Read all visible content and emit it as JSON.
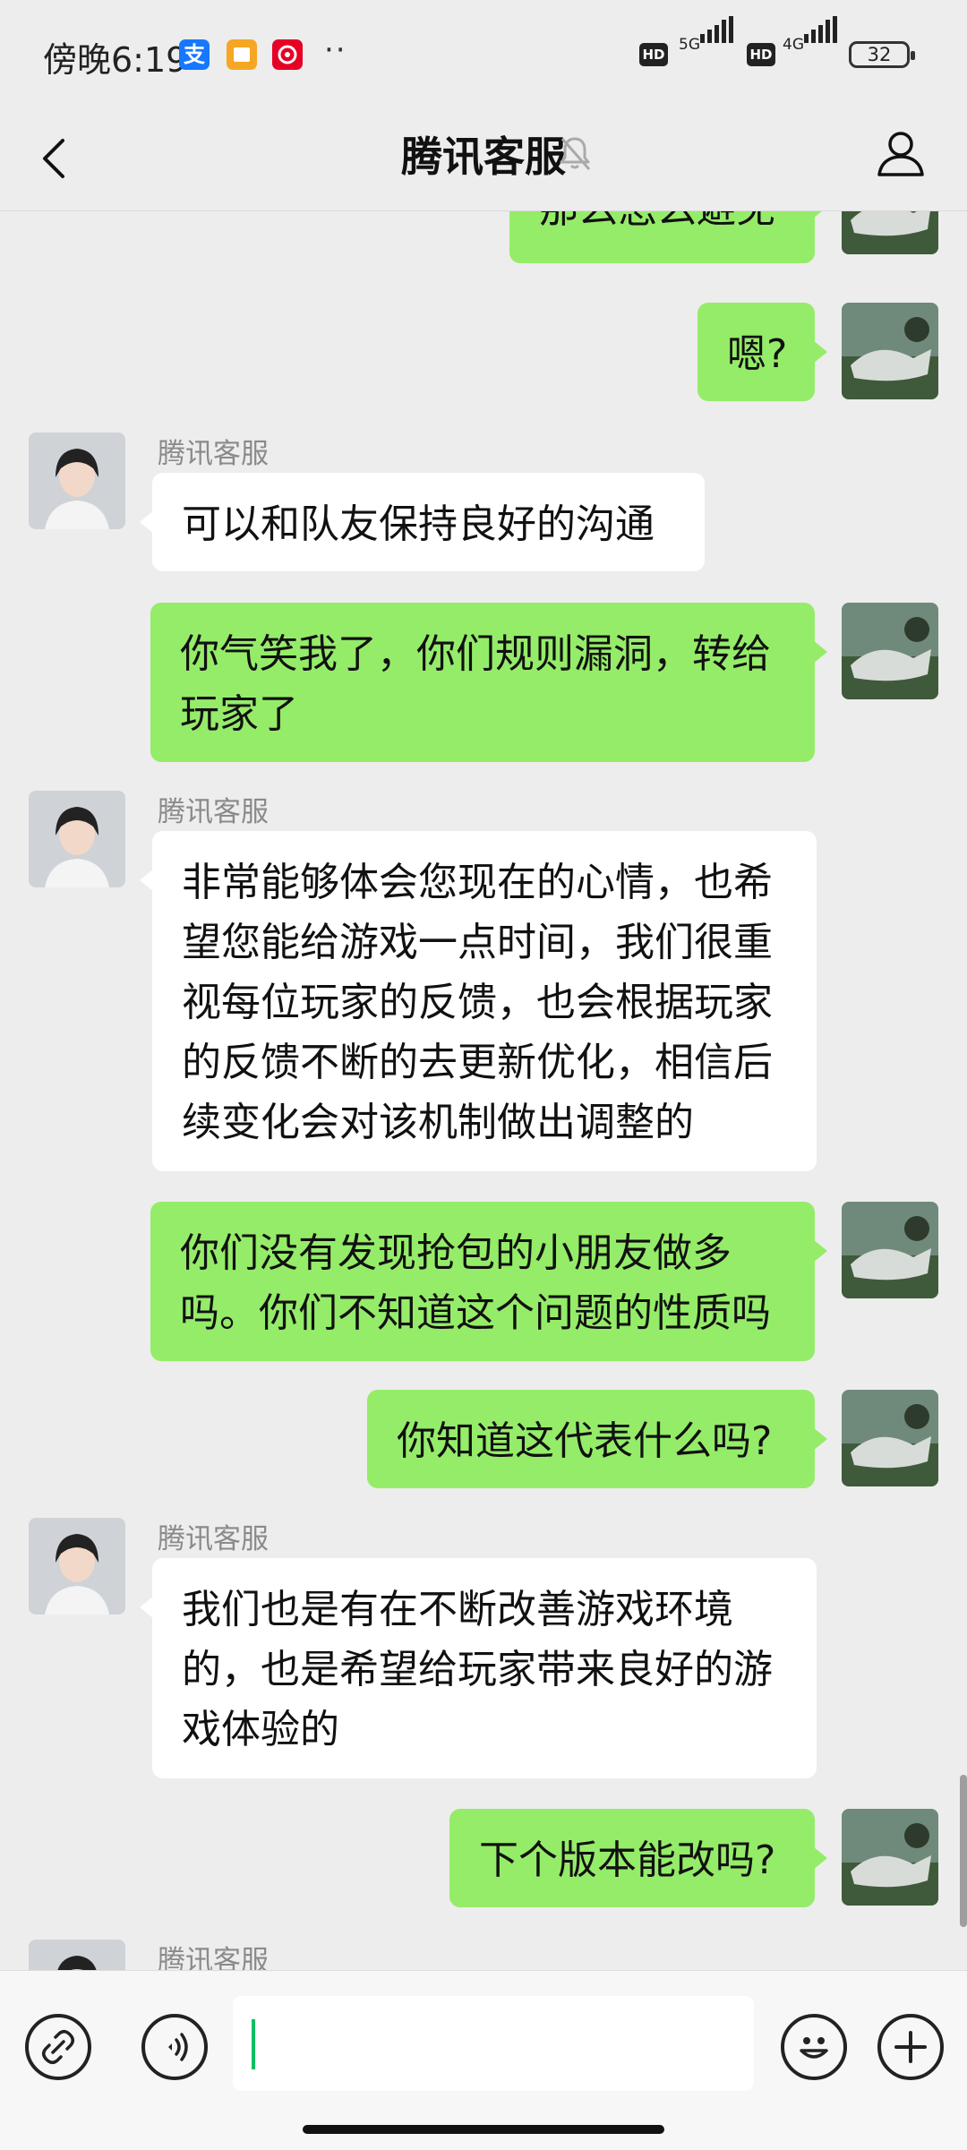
{
  "status_bar": {
    "time": "傍晚6:19",
    "app_icons": [
      {
        "name": "alipay-icon",
        "glyph": "支",
        "color": "#1677ff"
      },
      {
        "name": "notes-icon",
        "glyph": "",
        "color": "#f5a623"
      },
      {
        "name": "netease-music-icon",
        "glyph": "",
        "color": "#e60026"
      }
    ],
    "more": "··",
    "hd": "HD",
    "net1": "5G",
    "net2": "4G",
    "battery": "32"
  },
  "header": {
    "title": "腾讯客服",
    "icons": [
      "back-icon",
      "mute-bell-icon",
      "profile-icon"
    ]
  },
  "chat": {
    "sender_name": "腾讯客服",
    "messages": [
      {
        "from": "me",
        "text": "那么怎么避免"
      },
      {
        "from": "me",
        "text": "嗯?"
      },
      {
        "from": "cs",
        "text": "可以和队友保持良好的沟通"
      },
      {
        "from": "me",
        "text": "你气笑我了，你们规则漏洞，转给玩家了"
      },
      {
        "from": "cs",
        "text": "非常能够体会您现在的心情，也希望您能给游戏一点时间，我们很重视每位玩家的反馈，也会根据玩家的反馈不断的去更新优化，相信后续变化会对该机制做出调整的"
      },
      {
        "from": "me",
        "text": "你们没有发现抢包的小朋友做多吗。你们不知道这个问题的性质吗"
      },
      {
        "from": "me",
        "text": "你知道这代表什么吗?"
      },
      {
        "from": "cs",
        "text": "我们也是有在不断改善游戏环境的，也是希望给玩家带来良好的游戏体验的"
      },
      {
        "from": "me",
        "text": "下个版本能改吗?"
      }
    ]
  },
  "input_bar": {
    "icons": [
      "link-icon",
      "voice-icon",
      "emoji-icon",
      "plus-icon"
    ],
    "text_value": ""
  },
  "colors": {
    "background": "#ededed",
    "me_bubble": "#95ec69",
    "cs_bubble": "#ffffff",
    "caret": "#07c160"
  }
}
